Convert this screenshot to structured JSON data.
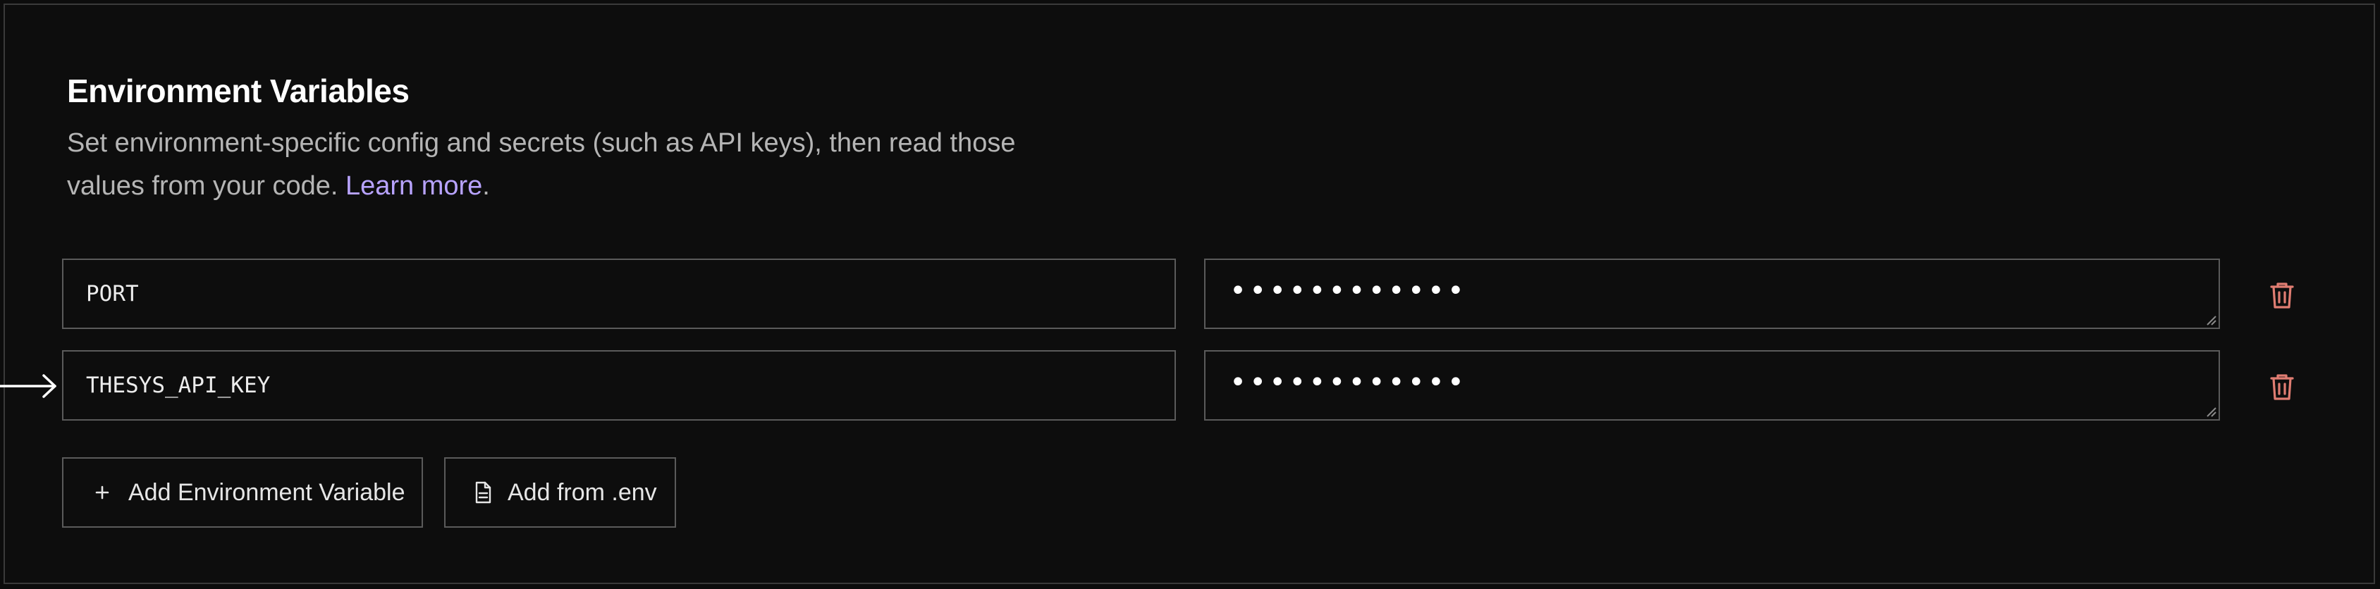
{
  "section": {
    "title": "Environment Variables",
    "description": "Set environment-specific config and secrets (such as API keys), then read those values from your code.",
    "learn_more": "Learn more",
    "trailing_period": "."
  },
  "env_vars": [
    {
      "key": "PORT",
      "value_masked": "••••••••••••"
    },
    {
      "key": "THESYS_API_KEY",
      "value_masked": "••••••••••••"
    }
  ],
  "actions": {
    "add_variable": "Add Environment Variable",
    "add_from_env": "Add from .env"
  },
  "icons": {
    "delete": "trash-icon",
    "add": "plus-icon",
    "file": "file-icon",
    "pointer": "arrow-right-icon",
    "resize": "resize-handle-icon"
  },
  "colors": {
    "background": "#0d0d0d",
    "border": "#5a5a5a",
    "link": "#b8a3ff",
    "delete_icon": "#e07d72"
  }
}
